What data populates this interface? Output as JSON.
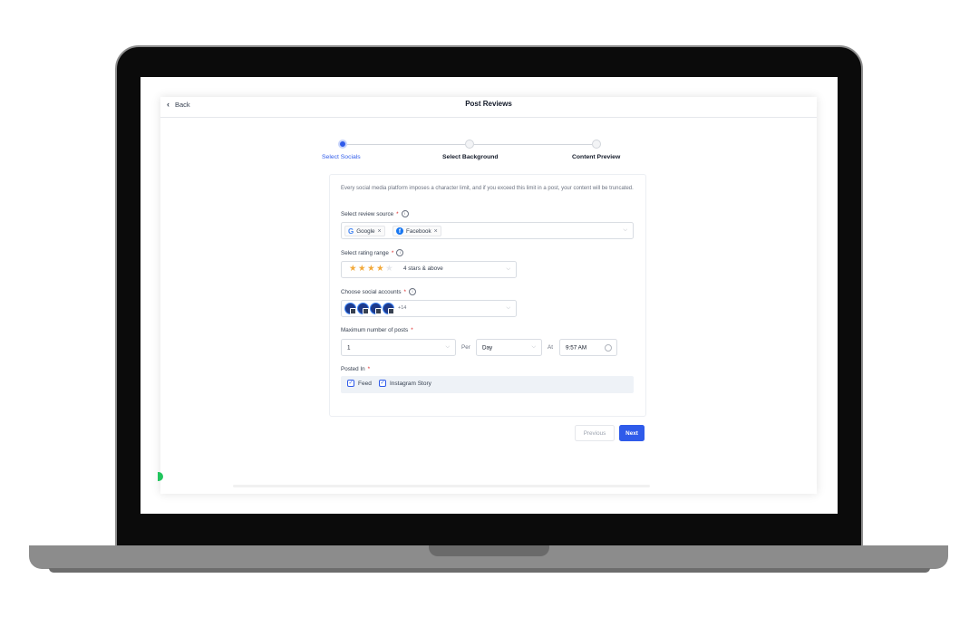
{
  "header": {
    "back_label": "Back",
    "title": "Post Reviews"
  },
  "stepper": {
    "steps": [
      {
        "label": "Select Socials",
        "state": "active"
      },
      {
        "label": "Select Background",
        "state": "inactive"
      },
      {
        "label": "Content Preview",
        "state": "inactive"
      }
    ]
  },
  "form": {
    "intro": "Every social media platform imposes a character limit, and if you exceed this limit in a post, your content will be truncated.",
    "review_source": {
      "label": "Select review source",
      "required_mark": "*",
      "tags": [
        {
          "label": "Google",
          "icon": "google-logo-icon"
        },
        {
          "label": "Facebook",
          "icon": "facebook-logo-icon"
        }
      ]
    },
    "rating": {
      "label": "Select rating range",
      "required_mark": "*",
      "stars_filled": 4,
      "stars_total": 5,
      "value": "4 stars & above"
    },
    "accounts": {
      "label": "Choose social accounts",
      "required_mark": "*",
      "more": "+14"
    },
    "max_posts": {
      "label": "Maximum number of posts",
      "required_mark": "*",
      "count": "1",
      "per_label": "Per",
      "period": "Day",
      "at_label": "At",
      "time": "9:57 AM"
    },
    "posted_in": {
      "label": "Posted In",
      "required_mark": "*",
      "options": [
        {
          "label": "Feed",
          "checked": true
        },
        {
          "label": "Instagram Story",
          "checked": true
        }
      ]
    }
  },
  "actions": {
    "previous_label": "Previous",
    "next_label": "Next"
  },
  "colors": {
    "accent": "#2f5bea",
    "star": "#f2a93b",
    "required": "#dc2626"
  }
}
